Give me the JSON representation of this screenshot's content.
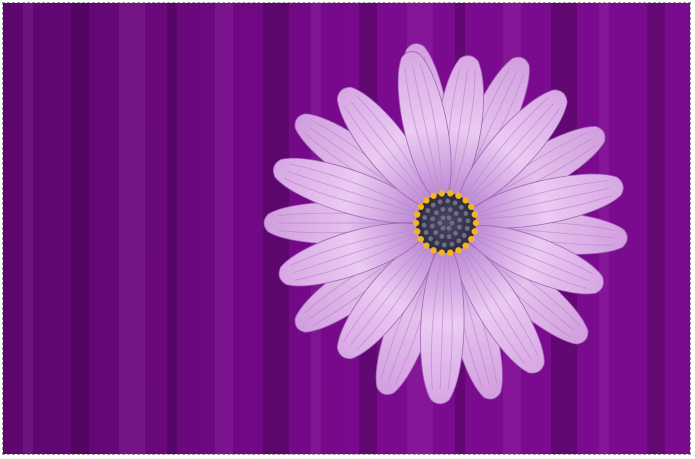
{
  "image": {
    "subject": "flower-icon",
    "background_color": "#7a0a8e",
    "background_color_dark": "#5e066f",
    "petal_color": "#d7a6e4",
    "petal_color_light": "#ebcbf2",
    "petal_color_deep": "#b57fcf",
    "center_color": "#2e2c3f",
    "pollen_color": "#f2b51f"
  }
}
